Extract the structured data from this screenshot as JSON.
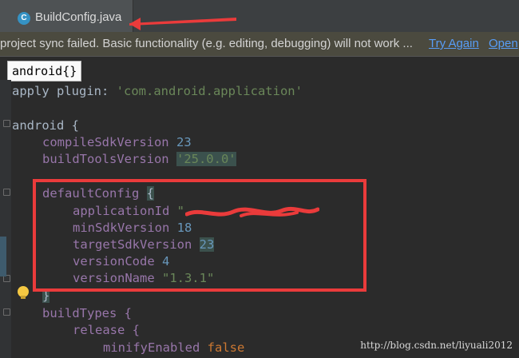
{
  "tab": {
    "title": "BuildConfig.java",
    "icon": "java-class-icon"
  },
  "banner": {
    "message": "project sync failed. Basic functionality (e.g. editing, debugging) will not work ...",
    "try_again": "Try Again",
    "open": "Open"
  },
  "breadcrumb": "android{}",
  "code": {
    "l1": {
      "a": "apply plugin: ",
      "b": "'com.android.application'"
    },
    "l2": {
      "a": "android {"
    },
    "l3": {
      "a": "compileSdkVersion ",
      "b": "23"
    },
    "l4": {
      "a": "buildToolsVersion ",
      "b": "'25.0.0'"
    },
    "l5": {
      "a": "defaultConfig ",
      "b": "{"
    },
    "l6": {
      "a": "applicationId ",
      "b": "\""
    },
    "l7": {
      "a": "minSdkVersion ",
      "b": "18"
    },
    "l8": {
      "a": "targetSdkVersion ",
      "b": "23"
    },
    "l9": {
      "a": "versionCode ",
      "b": "4"
    },
    "l10": {
      "a": "versionName ",
      "b": "\"1.3.1\""
    },
    "l11": {
      "a": "}"
    },
    "l12": {
      "a": "buildTypes {"
    },
    "l13": {
      "a": "release {"
    },
    "l14": {
      "a": "minifyEnabled ",
      "b": "false"
    }
  },
  "watermark": "http://blog.csdn.net/liyuali2012",
  "colors": {
    "annotation_red": "#ea3b3b",
    "keyword": "#cc7832",
    "string": "#6a8759",
    "number": "#6897bb",
    "property": "#9876aa"
  }
}
